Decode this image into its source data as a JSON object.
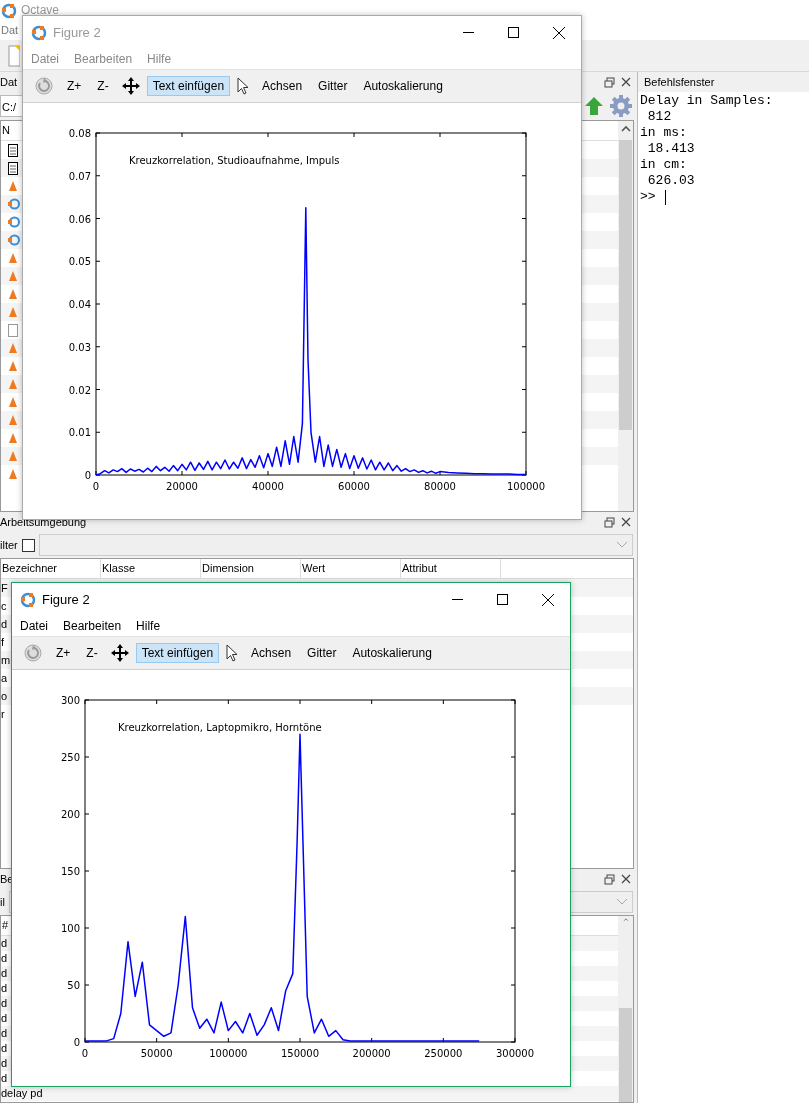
{
  "main_window": {
    "title": "Octave",
    "menu": [
      "Dat"
    ]
  },
  "file_browser": {
    "title": "Dat",
    "path": "C:/",
    "column": "N",
    "rows": [
      {
        "kind": "doc"
      },
      {
        "kind": "doc"
      },
      {
        "kind": "script"
      },
      {
        "kind": "figure"
      },
      {
        "kind": "figure"
      },
      {
        "kind": "figure"
      },
      {
        "kind": "script"
      },
      {
        "kind": "script"
      },
      {
        "kind": "script"
      },
      {
        "kind": "script"
      },
      {
        "kind": "blank"
      },
      {
        "kind": "script"
      },
      {
        "kind": "script"
      },
      {
        "kind": "script"
      },
      {
        "kind": "script"
      },
      {
        "kind": "script"
      },
      {
        "kind": "script"
      },
      {
        "kind": "script"
      },
      {
        "kind": "script"
      }
    ]
  },
  "workspace": {
    "title": "Arbeitsumgebung",
    "filter_label": "ilter",
    "filter_checked": false,
    "columns": [
      "Bezeichner",
      "Klasse",
      "Dimension",
      "Wert",
      "Attribut"
    ],
    "rows": [
      "F",
      "c",
      "d",
      "f",
      "m",
      "a",
      "o",
      "r"
    ]
  },
  "history": {
    "title": "Be",
    "filter_label": "il",
    "column": "#",
    "rows": [
      "d",
      "d",
      "d",
      "d",
      "d",
      "d",
      "d",
      "d",
      "d",
      "d",
      "delay pd"
    ]
  },
  "command_window": {
    "title": "Befehlsfenster",
    "lines": [
      "Delay in Samples:",
      " 812",
      "in ms:",
      " 18.413",
      "in cm:",
      " 626.03"
    ],
    "prompt": ">>"
  },
  "figures": [
    {
      "title": "Figure 2",
      "active": false,
      "menu": [
        "Datei",
        "Bearbeiten",
        "Hilfe"
      ],
      "toolbar": [
        {
          "kind": "rotate",
          "selected": false
        },
        {
          "kind": "text",
          "label": "Z+",
          "selected": false
        },
        {
          "kind": "text",
          "label": "Z-",
          "selected": false
        },
        {
          "kind": "pan",
          "selected": false
        },
        {
          "kind": "text",
          "label": "Text einfügen",
          "selected": true
        },
        {
          "kind": "pointer",
          "selected": false
        },
        {
          "kind": "text",
          "label": "Achsen",
          "selected": false
        },
        {
          "kind": "text",
          "label": "Gitter",
          "selected": false
        },
        {
          "kind": "text",
          "label": "Autoskalierung",
          "selected": false
        }
      ],
      "chart_data": {
        "type": "line",
        "x": [
          0,
          1000,
          2000,
          3000,
          4000,
          5000,
          6000,
          7000,
          8000,
          9000,
          10000,
          11000,
          12000,
          13000,
          14000,
          15000,
          16000,
          17000,
          18000,
          19000,
          20000,
          21000,
          22000,
          23000,
          24000,
          25000,
          26000,
          27000,
          28000,
          29000,
          30000,
          31000,
          32000,
          33000,
          34000,
          35000,
          36000,
          37000,
          38000,
          39000,
          40000,
          41000,
          42000,
          43000,
          44000,
          45000,
          46000,
          47000,
          48000,
          48800,
          49300,
          50000,
          51000,
          52000,
          53000,
          54000,
          55000,
          56000,
          57000,
          58000,
          59000,
          60000,
          61000,
          62000,
          63000,
          64000,
          65000,
          66000,
          67000,
          68000,
          69000,
          70000,
          71000,
          72000,
          73000,
          74000,
          75000,
          76000,
          77000,
          78000,
          79000,
          80000,
          82000,
          84000,
          86000,
          88000,
          90000,
          92000,
          94000,
          96000,
          98000,
          100000
        ],
        "series": [
          {
            "color": "#0000ff",
            "values": [
              0,
              0.0003,
              0.001,
              0.0005,
              0.0012,
              0.0008,
              0.0015,
              0.0006,
              0.0014,
              0.0009,
              0.0013,
              0.0007,
              0.0016,
              0.0008,
              0.002,
              0.001,
              0.0018,
              0.0009,
              0.0022,
              0.001,
              0.0025,
              0.0012,
              0.003,
              0.0011,
              0.0028,
              0.0013,
              0.0032,
              0.0012,
              0.003,
              0.0015,
              0.0035,
              0.0014,
              0.003,
              0.0016,
              0.004,
              0.0015,
              0.0036,
              0.0018,
              0.0045,
              0.0017,
              0.005,
              0.002,
              0.0065,
              0.002,
              0.008,
              0.0025,
              0.009,
              0.003,
              0.012,
              0.0625,
              0.027,
              0.01,
              0.003,
              0.009,
              0.002,
              0.007,
              0.002,
              0.006,
              0.0018,
              0.005,
              0.0015,
              0.0045,
              0.0016,
              0.004,
              0.0014,
              0.0035,
              0.0012,
              0.003,
              0.0012,
              0.0028,
              0.001,
              0.0022,
              0.0009,
              0.0015,
              0.0008,
              0.0012,
              0.0006,
              0.001,
              0.0005,
              0.0009,
              0.0004,
              0.0008,
              0.0006,
              0.0005,
              0.0004,
              0.0003,
              0.0003,
              0.0002,
              0.0002,
              0.0002,
              0.0001,
              0.0001
            ]
          }
        ],
        "xlim": [
          0,
          100000
        ],
        "ylim": [
          0,
          0.08
        ],
        "xticks": [
          0,
          20000,
          40000,
          60000,
          80000,
          100000
        ],
        "yticks": [
          0,
          0.01,
          0.02,
          0.03,
          0.04,
          0.05,
          0.06,
          0.07,
          0.08
        ],
        "annotations": [
          "Kreuzkorrelation, Studioaufnahme, Impuls"
        ]
      }
    },
    {
      "title": "Figure 2",
      "active": true,
      "menu": [
        "Datei",
        "Bearbeiten",
        "Hilfe"
      ],
      "toolbar": [
        {
          "kind": "rotate",
          "selected": false
        },
        {
          "kind": "text",
          "label": "Z+",
          "selected": false
        },
        {
          "kind": "text",
          "label": "Z-",
          "selected": false
        },
        {
          "kind": "pan",
          "selected": false
        },
        {
          "kind": "text",
          "label": "Text einfügen",
          "selected": true
        },
        {
          "kind": "pointer",
          "selected": false
        },
        {
          "kind": "text",
          "label": "Achsen",
          "selected": false
        },
        {
          "kind": "text",
          "label": "Gitter",
          "selected": false
        },
        {
          "kind": "text",
          "label": "Autoskalierung",
          "selected": false
        }
      ],
      "chart_data": {
        "type": "line",
        "x": [
          0,
          5000,
          10000,
          15000,
          20000,
          25000,
          30000,
          35000,
          40000,
          45000,
          50000,
          55000,
          60000,
          65000,
          70000,
          75000,
          80000,
          85000,
          90000,
          95000,
          100000,
          105000,
          110000,
          115000,
          120000,
          125000,
          130000,
          135000,
          140000,
          145000,
          148000,
          150000,
          155000,
          160000,
          165000,
          170000,
          175000,
          180000,
          185000,
          190000,
          200000,
          225000,
          250000,
          275000
        ],
        "series": [
          {
            "color": "#0000ff",
            "values": [
              1,
              1,
              1,
              1,
              3,
              25,
              88,
              40,
              70,
              15,
              10,
              5,
              8,
              50,
              110,
              30,
              12,
              20,
              8,
              35,
              10,
              18,
              8,
              25,
              6,
              15,
              30,
              10,
              45,
              60,
              175,
              270,
              40,
              8,
              20,
              5,
              10,
              2,
              1,
              1,
              1,
              1,
              1,
              1
            ]
          }
        ],
        "xlim": [
          0,
          300000
        ],
        "ylim": [
          0,
          300
        ],
        "xticks": [
          0,
          50000,
          100000,
          150000,
          200000,
          250000,
          300000
        ],
        "yticks": [
          0,
          50,
          100,
          150,
          200,
          250,
          300
        ],
        "annotations": [
          "Kreuzkorrelation, Laptopmikro, Horntöne"
        ]
      }
    }
  ]
}
